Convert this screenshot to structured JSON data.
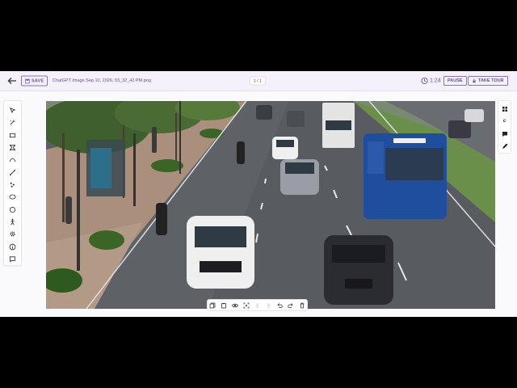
{
  "header": {
    "save_label": "SAVE",
    "filename": "ChatGPT Image Sep 10, 2026, 03_32_42 PM.png",
    "page_indicator": "1 / 1",
    "timer": "1:24",
    "pause_label": "PAUSE",
    "tour_label": "TAKE TOUR"
  },
  "left_tools": [
    "cursor-icon",
    "magic-select-icon",
    "rectangle-icon",
    "polygon-icon",
    "curve-icon",
    "line-icon",
    "points-icon",
    "ellipse-icon",
    "circle-icon",
    "skeleton-icon",
    "settings-icon",
    "info-icon",
    "comment-icon"
  ],
  "right_tools": {
    "labels": [
      "",
      "c",
      "",
      ""
    ],
    "icons": [
      "grid-icon",
      "text-c-icon",
      "chat-icon",
      "pen-icon"
    ]
  },
  "bottom_tools": [
    "copy-icon",
    "paste-icon",
    "eye-icon",
    "focus-icon",
    "prev-icon",
    "next-icon",
    "undo-icon",
    "redo-icon",
    "delete-icon"
  ],
  "colors": {
    "accent": "#6a4fb0",
    "header_bg": "#f4f1fa",
    "canvas_bg": "#5a5e62"
  },
  "scene": "street photo with cars, a blue bus, and motorcycles"
}
